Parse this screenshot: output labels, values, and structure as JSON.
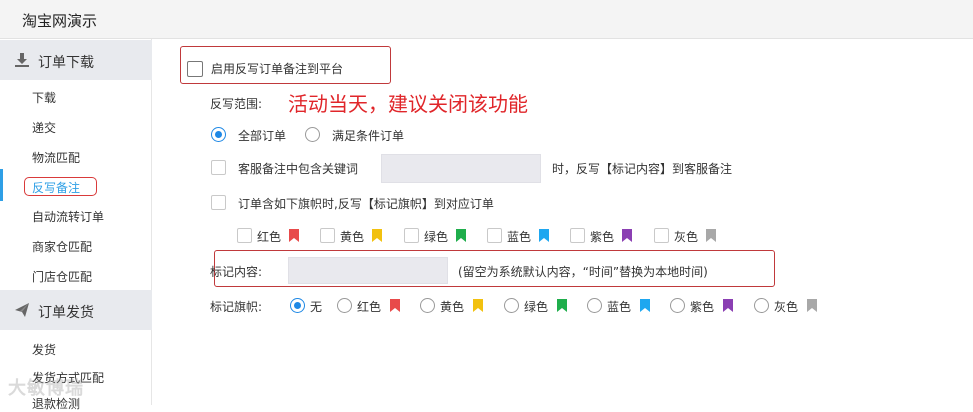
{
  "app": {
    "title": "淘宝网演示"
  },
  "sidebar": {
    "groups": [
      {
        "label": "订单下载",
        "icon": "download-icon",
        "items": [
          "下载",
          "递交",
          "物流匹配",
          "反写备注",
          "自动流转订单",
          "商家仓匹配",
          "门店仓匹配"
        ]
      },
      {
        "label": "订单发货",
        "icon": "send-icon",
        "items": [
          "发货",
          "发货方式匹配",
          "退款检测"
        ]
      }
    ],
    "active_item": "反写备注"
  },
  "watermark": "大敏博瑞",
  "form": {
    "enable_label": "启用反写订单备注到平台",
    "enable_checked": false,
    "scope_label": "反写范围:",
    "annotation": "活动当天，建议关闭该功能",
    "scope_options": [
      {
        "label": "全部订单",
        "selected": true
      },
      {
        "label": "满足条件订单",
        "selected": false
      }
    ],
    "keyword_label": "客服备注中包含关键词",
    "keyword_value": "",
    "keyword_suffix": "时，反写【标记内容】到客服备注",
    "flag_rule_label": "订单含如下旗帜时,反写【标记旗帜】到对应订单",
    "flag_checks": [
      {
        "label": "红色",
        "color": "#e84a4a"
      },
      {
        "label": "黄色",
        "color": "#f2c10f"
      },
      {
        "label": "绿色",
        "color": "#1fae4c"
      },
      {
        "label": "蓝色",
        "color": "#1ea7f0"
      },
      {
        "label": "紫色",
        "color": "#8b3fb3"
      },
      {
        "label": "灰色",
        "color": "#a8a8a8"
      }
    ],
    "mark_content_label": "标记内容:",
    "mark_content_value": "",
    "mark_content_hint": "(留空为系统默认内容，“时间”替换为本地时间)",
    "mark_flag_label": "标记旗帜:",
    "mark_flag_options": [
      {
        "label": "无",
        "selected": true
      },
      {
        "label": "红色",
        "color": "#e84a4a"
      },
      {
        "label": "黄色",
        "color": "#f2c10f"
      },
      {
        "label": "绿色",
        "color": "#1fae4c"
      },
      {
        "label": "蓝色",
        "color": "#1ea7f0"
      },
      {
        "label": "紫色",
        "color": "#8b3fb3"
      },
      {
        "label": "灰色",
        "color": "#a8a8a8"
      }
    ]
  }
}
